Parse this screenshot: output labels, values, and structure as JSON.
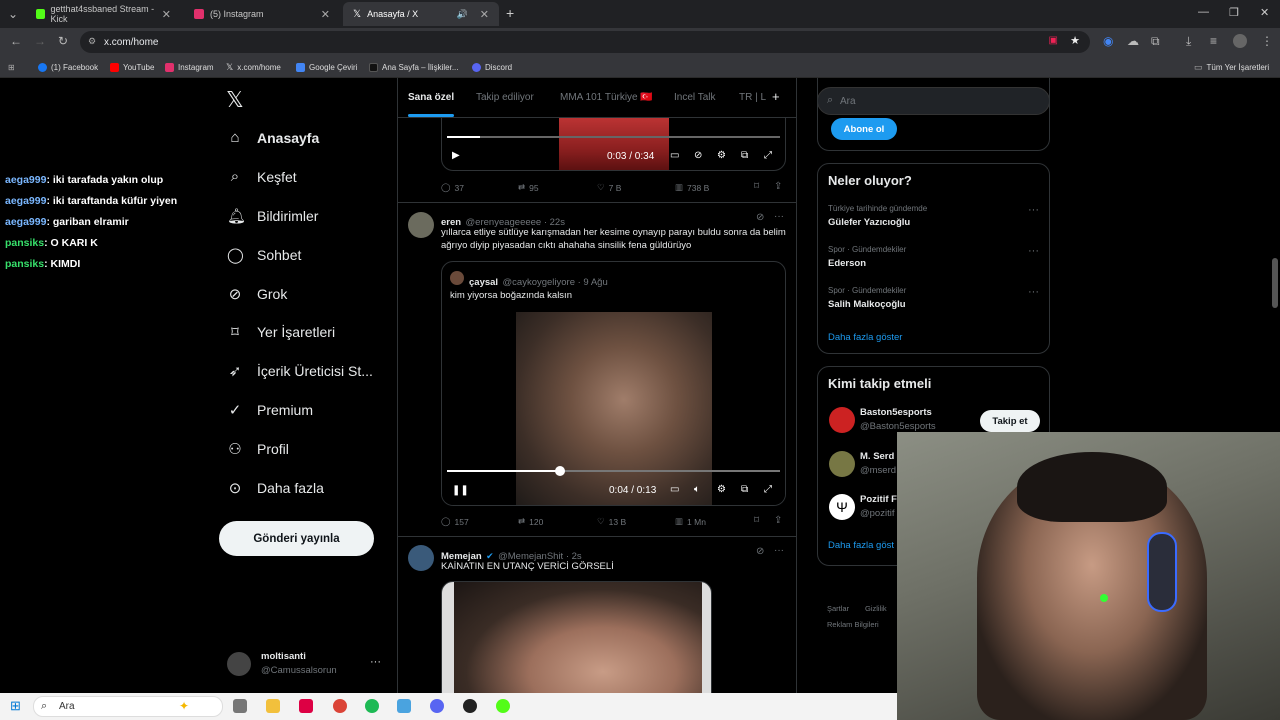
{
  "browser": {
    "tabs": [
      {
        "label": "getthat4ssbaned Stream - Kick",
        "color": "#53fc18"
      },
      {
        "label": "(5) Instagram",
        "color": "#e1306c"
      },
      {
        "label": "Anasayfa / X",
        "color": "#ffffff"
      }
    ],
    "url": "x.com/home",
    "bookmarks": [
      "(1) Facebook",
      "YouTube",
      "Instagram",
      "x.com/home",
      "Google Çeviri",
      "Ana Sayfa – İlişkiler...",
      "Discord"
    ],
    "all_bookmarks": "Tüm Yer İşaretleri"
  },
  "chat": [
    {
      "user": "aega999",
      "msg": ": iki tarafada yakın olup"
    },
    {
      "user": "aega999",
      "msg": ": iki taraftanda küfür yiyen"
    },
    {
      "user": "aega999",
      "msg": ": gariban elramir"
    },
    {
      "user": "pansiks",
      "msg": ": O KARI K"
    },
    {
      "user": "pansiks",
      "msg": ": KIMDI"
    }
  ],
  "nav": {
    "items": [
      "Anasayfa",
      "Keşfet",
      "Bildirimler",
      "Sohbet",
      "Grok",
      "Yer İşaretleri",
      "İçerik Üreticisi St...",
      "Premium",
      "Profil",
      "Daha fazla"
    ],
    "post_button": "Gönderi yayınla",
    "account_name": "moltisanti",
    "account_handle": "@Camussalsorun"
  },
  "timeline": {
    "tabs": [
      "Sana özel",
      "Takip ediliyor",
      "MMA 101 Türkiye 🇹🇷",
      "Incel Talk",
      "TR | L"
    ],
    "tweet1": {
      "video_time": "0:03 / 0:34",
      "progress": 0.1,
      "replies": "37",
      "reposts": "95",
      "likes": "7 B",
      "views": "738 B"
    },
    "tweet2": {
      "name": "eren",
      "handle": "@erenyeageeeee · 22s",
      "text": "yıllarca etliye sütlüye karışmadan her kesime oynayıp parayı buldu sonra da belim ağrıyo diyip piyasadan cıktı ahahaha sinsilik fena güldürüyo",
      "quote_name": "çaysal",
      "quote_handle": "@caykoygeliyore · 9 Ağu",
      "quote_text": "kim yiyorsa boğazında kalsın",
      "video_time": "0:04 / 0:13",
      "progress": 0.34,
      "replies": "157",
      "reposts": "120",
      "likes": "13 B",
      "views": "1 Mn"
    },
    "tweet3": {
      "name": "Memejan",
      "handle": "@MemejanShit · 2s",
      "text": "KAİNATIN EN UTANÇ VERİCİ GÖRSELİ"
    }
  },
  "sidebar": {
    "search_placeholder": "Ara",
    "subscribe": "Abone ol",
    "trends_title": "Neler oluyor?",
    "trends": [
      {
        "category": "Türkiye tarihinde gündemde",
        "name": "Gülefer Yazıcıoğlu"
      },
      {
        "category": "Spor · Gündemdekiler",
        "name": "Ederson"
      },
      {
        "category": "Spor · Gündemdekiler",
        "name": "Salih Malkoçoğlu"
      }
    ],
    "show_more": "Daha fazla göster",
    "follow_title": "Kimi takip etmeli",
    "follow": [
      {
        "name": "Baston5esports",
        "handle": "@Baston5esports"
      },
      {
        "name": "M. Serd",
        "handle": "@mserd"
      },
      {
        "name": "Pozitif F",
        "handle": "@pozitif"
      }
    ],
    "follow_button": "Takip et",
    "show_more2": "Daha fazla göst",
    "footer": [
      "Şartlar",
      "Gizlilik",
      "Reklam Bilgileri"
    ]
  },
  "taskbar": {
    "search": "Ara"
  }
}
